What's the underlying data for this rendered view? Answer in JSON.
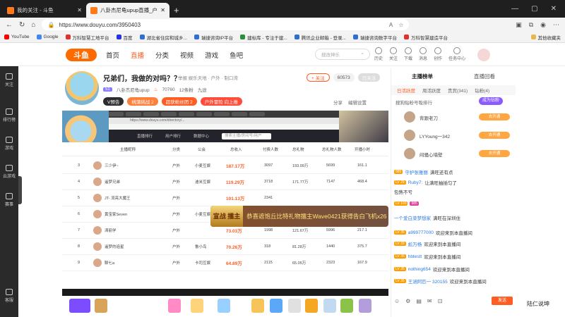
{
  "browser": {
    "tabs": [
      {
        "title": "我的关注 - 斗鱼",
        "favicon_color": "#ff7a1a",
        "active": false
      },
      {
        "title": "八卦杰尼龟upup直播_户外...",
        "favicon_color": "#ff7a1a",
        "active": true
      }
    ],
    "new_tab_glyph": "+",
    "url": "https://www.douyu.com/3950403",
    "bookmarks": [
      {
        "label": "YouTube",
        "color": "#ff0000"
      },
      {
        "label": "Google",
        "color": "#4285f4"
      },
      {
        "label": "万科智慧工地平台",
        "color": "#e03030"
      },
      {
        "label": "百度",
        "color": "#2932e1"
      },
      {
        "label": "湖北省住房和城乡...",
        "color": "#2f6fd3"
      },
      {
        "label": "瑞捷咨询IP平台",
        "color": "#2f6fd3"
      },
      {
        "label": "建标库 - 专注于建...",
        "color": "#2a8e3c"
      },
      {
        "label": "腾讯企业邮箱 - 登录...",
        "color": "#2f6fd3"
      },
      {
        "label": "瑞捷咨询数字平台",
        "color": "#2f6fd3"
      },
      {
        "label": "万科智慧建造平台",
        "color": "#e03030"
      }
    ],
    "bookmark_overflow": "其他收藏夹"
  },
  "site": {
    "logo": "斗鱼",
    "nav": [
      {
        "label": "首页",
        "active": false
      },
      {
        "label": "直播",
        "active": true
      },
      {
        "label": "分类",
        "active": false
      },
      {
        "label": "视频",
        "active": false
      },
      {
        "label": "游戏",
        "active": false
      },
      {
        "label": "鱼吧",
        "active": false
      }
    ],
    "search_placeholder": "搜改神乐",
    "header_icons": [
      "历史",
      "关注",
      "下载",
      "消息",
      "创作",
      "任务中心"
    ]
  },
  "sidebar": {
    "items": [
      "关注",
      "排行榜",
      "游戏",
      "云游戏",
      "赛事",
      "客服"
    ]
  },
  "room": {
    "title": "兄弟们，我做的对吗？？",
    "tag": "举报  娱乐天地 · 户外 · 制口湾",
    "level": "51",
    "streamer": "八卦杰尼龟upup",
    "hot": "70760",
    "follow_count": "12条粉",
    "tag2": "九途",
    "follow_button": "+ 关注",
    "fans": "60573",
    "fans_button": "已关注",
    "badges": [
      "V预告",
      "桃蒲挑战 2",
      "超获粉丝团 2",
      "户外冒险 向上推"
    ],
    "actions": [
      "分享",
      "编辑设置"
    ]
  },
  "video": {
    "inner_url": "https://www.douyu.com/directory/...",
    "inner_nav": [
      "直播排行",
      "用户排行",
      "数据中心"
    ],
    "inner_search": "搜索主播/房间号/用户",
    "table_headers": [
      "主播昵称",
      "分类",
      "公会",
      "总收入",
      "付费人数",
      "总礼物",
      "总礼物人数",
      "开播小时"
    ],
    "rows": [
      {
        "rank": "3",
        "name": "三少伊~",
        "cat": "户外",
        "guild": "小麦互娱",
        "income": "187.17万",
        "payers": "3097",
        "gifts": "193.09万",
        "gifters": "5699",
        "hours": "161.1"
      },
      {
        "rank": "4",
        "name": "遥梦兄弟",
        "cat": "户外",
        "guild": "迪米互娱",
        "income": "119.29万",
        "payers": "3718",
        "gifts": "171.77万",
        "gifters": "7147",
        "hours": "468.4"
      },
      {
        "rank": "5",
        "name": "JT- 流亮大魔王",
        "cat": "户外",
        "guild": "",
        "income": "101.13万",
        "payers": "2341",
        "gifts": "",
        "gifters": "",
        "hours": ""
      },
      {
        "rank": "6",
        "name": "黄宝家Seven",
        "cat": "户外",
        "guild": "小麦互娱",
        "income": "",
        "payers": "",
        "gifts": "",
        "gifters": "",
        "hours": ""
      },
      {
        "rank": "7",
        "name": "涛丽学",
        "cat": "户外",
        "guild": "",
        "income": "73.03万",
        "payers": "1998",
        "gifts": "121.67万",
        "gifters": "5996",
        "hours": "217.1"
      },
      {
        "rank": "8",
        "name": "遥梦的追星",
        "cat": "户外",
        "guild": "鲁小鸟",
        "income": "70.26万",
        "payers": "318",
        "gifts": "81.28万",
        "gifters": "1440",
        "hours": "375.7"
      },
      {
        "rank": "9",
        "name": "聊七a",
        "cat": "户外",
        "guild": "卡司互娱",
        "income": "64.89万",
        "payers": "2115",
        "gifts": "65.05万",
        "gifters": "2323",
        "hours": "167.9"
      }
    ],
    "banner_crest": "宣战 擂主",
    "banner_text": "恭喜遮饱丘比特礼物擂主Wave0421获得告白飞机x26"
  },
  "chat": {
    "tabs": [
      "主播榜单",
      "直播回看"
    ],
    "sub_tabs": [
      "日活跃度",
      "周活跃度",
      "贵宾(341)",
      "钻粉(4)"
    ],
    "rank_title": "搜狗贴粉号吸排行",
    "rank_button": "成为钻粉",
    "ranks": [
      {
        "name": "背跟老刀",
        "badge": "去开通"
      },
      {
        "name": "LYYoung一342",
        "badge": "去开通"
      },
      {
        "name": "闷骚心墙壁",
        "badge": "去开通"
      }
    ],
    "messages": [
      {
        "lv": "985",
        "user": "守护张雅丽",
        "text": "满旺还有点"
      },
      {
        "lv": "LV 29",
        "user": "Ruby7:",
        "text": "让满旺抽插匀了"
      },
      {
        "lv": "",
        "user": "",
        "text": "包熱不亏"
      },
      {
        "lv": "LV 100",
        "user": "985",
        "text": ""
      },
      {
        "lv": "",
        "user": "一个爱白菜梦想家",
        "text": "满旺在深圳住"
      },
      {
        "lv": "LV 35",
        "user": "a999777000",
        "text": "欢迎来到本直播间"
      },
      {
        "lv": "LV 33",
        "user": "彪万杨",
        "text": "欢迎来到本直播间"
      },
      {
        "lv": "LV 35",
        "user": "hbtestt",
        "text": "欢迎来到本直播间"
      },
      {
        "lv": "LV 35",
        "user": "nothing654",
        "text": "欢迎来到本直播间"
      },
      {
        "lv": "LV 35",
        "user": "王涵阿匹一 320155",
        "text": "欢迎来到本直播间"
      }
    ],
    "send_label": "发送",
    "watermark": "陆仁说坤"
  },
  "colors": {
    "brand": "#ff5d23",
    "accent_purple": "#8a5cff",
    "tab_dark": "#1f1f1f"
  }
}
